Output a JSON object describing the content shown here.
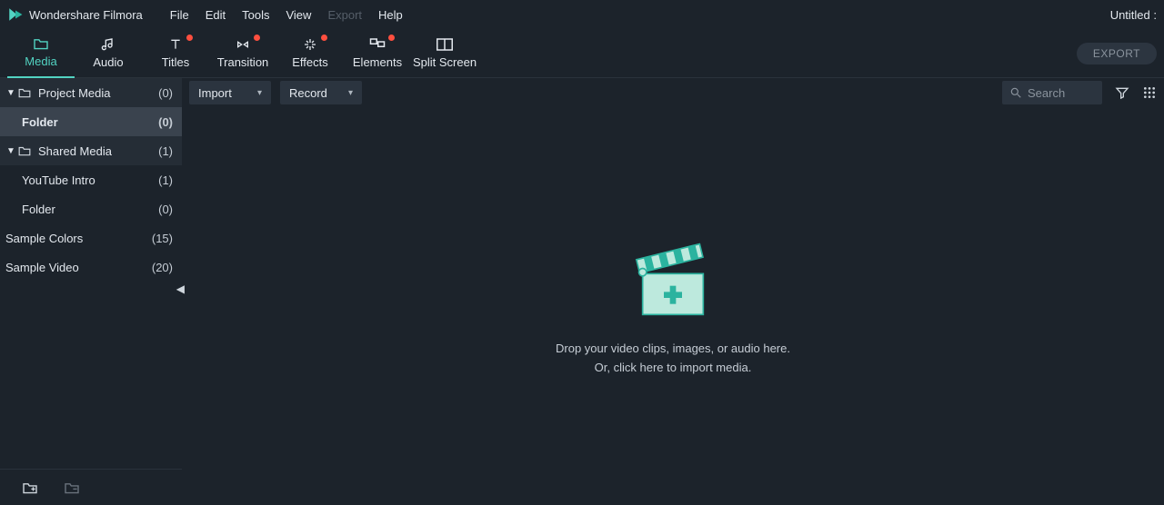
{
  "app_title": "Wondershare Filmora",
  "doc_title": "Untitled :",
  "menu": {
    "file": "File",
    "edit": "Edit",
    "tools": "Tools",
    "view": "View",
    "export": "Export",
    "help": "Help"
  },
  "tool_tabs": {
    "media": "Media",
    "audio": "Audio",
    "titles": "Titles",
    "transition": "Transition",
    "effects": "Effects",
    "elements": "Elements",
    "split_screen": "Split Screen"
  },
  "export_button": "EXPORT",
  "sidebar": {
    "items": [
      {
        "label": "Project Media",
        "count": "(0)"
      },
      {
        "label": "Folder",
        "count": "(0)"
      },
      {
        "label": "Shared Media",
        "count": "(1)"
      },
      {
        "label": "YouTube Intro",
        "count": "(1)"
      },
      {
        "label": "Folder",
        "count": "(0)"
      },
      {
        "label": "Sample Colors",
        "count": "(15)"
      },
      {
        "label": "Sample Video",
        "count": "(20)"
      }
    ]
  },
  "main": {
    "import_label": "Import",
    "record_label": "Record",
    "search_placeholder": "Search",
    "drop_line1": "Drop your video clips, images, or audio here.",
    "drop_line2": "Or, click here to import media."
  }
}
